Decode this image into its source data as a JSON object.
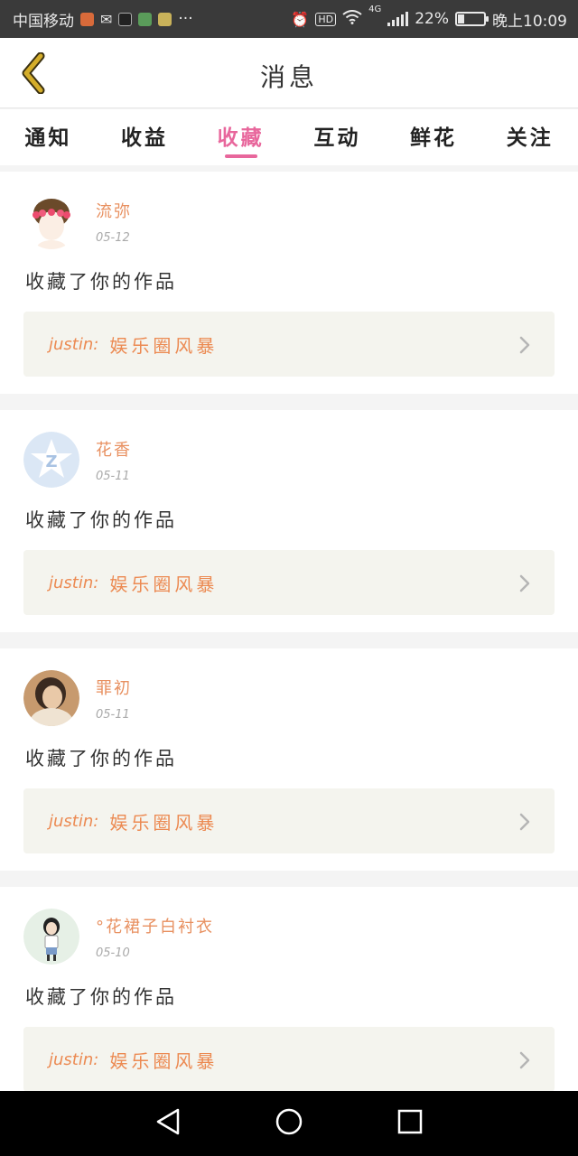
{
  "status_bar": {
    "carrier": "中国移动",
    "more": "···",
    "network": "4G",
    "battery": "22%",
    "battery_level": 0.22,
    "time": "晚上10:09"
  },
  "header": {
    "title": "消息"
  },
  "tabs": [
    {
      "label": "通知",
      "active": false
    },
    {
      "label": "收益",
      "active": false
    },
    {
      "label": "收藏",
      "active": true
    },
    {
      "label": "互动",
      "active": false
    },
    {
      "label": "鲜花",
      "active": false
    },
    {
      "label": "关注",
      "active": false
    }
  ],
  "items": [
    {
      "user": "流弥",
      "date": "05-12",
      "action": "收藏了你的作品",
      "author": "justin:",
      "work": "娱乐圈风暴"
    },
    {
      "user": "花香",
      "date": "05-11",
      "action": "收藏了你的作品",
      "author": "justin:",
      "work": "娱乐圈风暴"
    },
    {
      "user": "罪初",
      "date": "05-11",
      "action": "收藏了你的作品",
      "author": "justin:",
      "work": "娱乐圈风暴"
    },
    {
      "user": "°花裙子白衬衣",
      "date": "05-10",
      "action": "收藏了你的作品",
      "author": "justin:",
      "work": "娱乐圈风暴"
    }
  ],
  "colors": {
    "accent": "#e8679c",
    "name": "#e89060",
    "work": "#ec8a52",
    "back_arrow": "#c9a227"
  }
}
